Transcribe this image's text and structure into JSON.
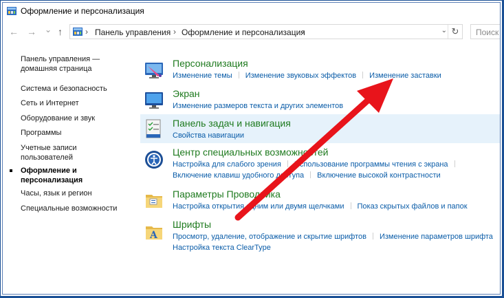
{
  "window": {
    "title": "Оформление и персонализация"
  },
  "navigation": {
    "back_icon": "←",
    "forward_icon": "→",
    "dropdown_icon": "⌄",
    "up_icon": "↑"
  },
  "address": {
    "crumbs": [
      "Панель управления",
      "Оформление и персонализация"
    ],
    "separator": "›",
    "refresh": "↻"
  },
  "search": {
    "placeholder": "Поиск в"
  },
  "sidebar": {
    "items": [
      {
        "label": "Панель управления —"
      },
      {
        "label": "домашняя страница"
      },
      {
        "label": "Система и безопасность"
      },
      {
        "label": "Сеть и Интернет"
      },
      {
        "label": "Оборудование и звук"
      },
      {
        "label": "Программы"
      },
      {
        "label": "Учетные записи"
      },
      {
        "label": "пользователей"
      },
      {
        "label": "Оформление и"
      },
      {
        "label": "персонализация"
      },
      {
        "label": "Часы, язык и регион"
      },
      {
        "label": "Специальные возможности"
      }
    ]
  },
  "categories": [
    {
      "title": "Персонализация",
      "links": [
        [
          "Изменение темы",
          "Изменение звуковых эффектов",
          "Изменение заставки"
        ]
      ]
    },
    {
      "title": "Экран",
      "links": [
        [
          "Изменение размеров текста и других элементов"
        ]
      ]
    },
    {
      "title": "Панель задач и навигация",
      "links": [
        [
          "Свойства навигации"
        ]
      ]
    },
    {
      "title": "Центр специальных возможностей",
      "links": [
        [
          "Настройка для слабого зрения",
          "Использование программы чтения с экрана"
        ],
        [
          "Включение клавиш удобного доступа",
          "Включение высокой контрастности"
        ]
      ]
    },
    {
      "title": "Параметры Проводника",
      "links": [
        [
          "Настройка открытия одним или двумя щелчками",
          "Показ скрытых файлов и папок"
        ]
      ]
    },
    {
      "title": "Шрифты",
      "links": [
        [
          "Просмотр, удаление, отображение и скрытие шрифтов",
          "Изменение параметров шрифта"
        ],
        [
          "Настройка текста ClearType"
        ]
      ]
    }
  ],
  "colors": {
    "category_title": "#1e7a1e",
    "link": "#0a5ca8",
    "frame": "#1a4f95",
    "arrow": "#e8141b"
  }
}
